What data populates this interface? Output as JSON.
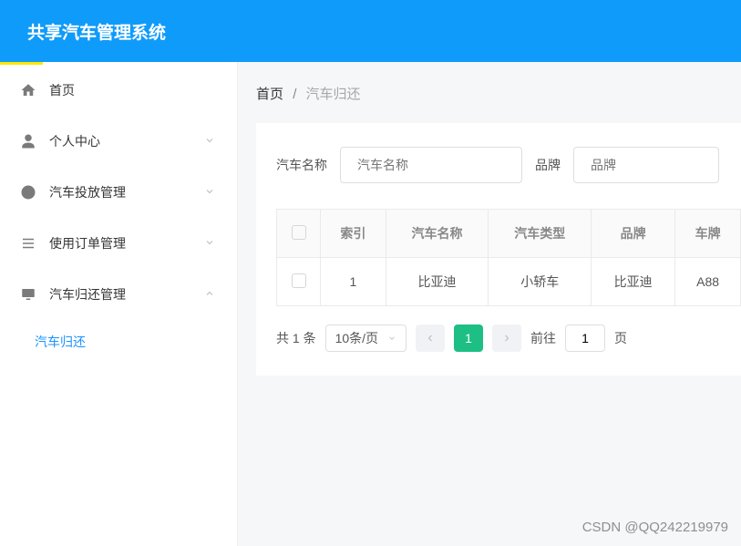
{
  "header": {
    "title": "共享汽车管理系统"
  },
  "sidebar": {
    "items": [
      {
        "label": "首页"
      },
      {
        "label": "个人中心"
      },
      {
        "label": "汽车投放管理"
      },
      {
        "label": "使用订单管理"
      },
      {
        "label": "汽车归还管理"
      }
    ],
    "sub": {
      "label": "汽车归还"
    }
  },
  "breadcrumb": {
    "home": "首页",
    "sep": "/",
    "current": "汽车归还"
  },
  "search": {
    "name_label": "汽车名称",
    "name_placeholder": "汽车名称",
    "brand_label": "品牌",
    "brand_placeholder": "品牌"
  },
  "table": {
    "headers": [
      "",
      "索引",
      "汽车名称",
      "汽车类型",
      "品牌",
      "车牌"
    ],
    "rows": [
      {
        "index": "1",
        "name": "比亚迪",
        "type": "小轿车",
        "brand": "比亚迪",
        "plate": "A88"
      }
    ]
  },
  "pager": {
    "total": "共 1 条",
    "page_size": "10条/页",
    "current": "1",
    "goto_pre": "前往",
    "goto_val": "1",
    "goto_post": "页"
  },
  "watermark": "CSDN @QQ242219979"
}
